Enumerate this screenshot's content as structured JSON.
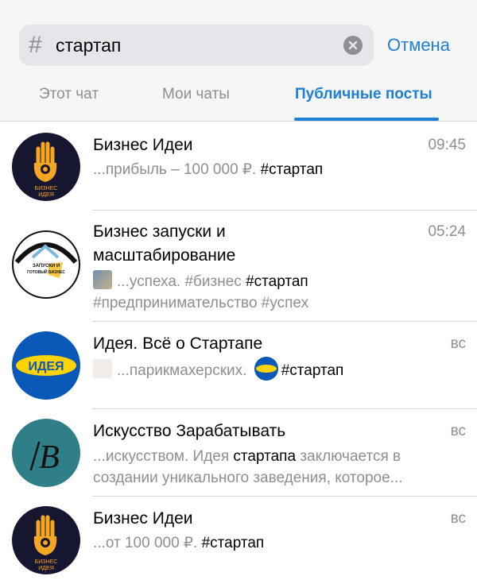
{
  "search": {
    "hash": "#",
    "query": "стартап",
    "cancel_label": "Отмена"
  },
  "tabs": [
    {
      "label": "Этот чат"
    },
    {
      "label": "Мои чаты"
    },
    {
      "label": "Публичные посты"
    }
  ],
  "results": [
    {
      "title": "Бизнес Идеи",
      "time": "09:45",
      "snippet_pre": "...прибыль – 100 000 ₽. ",
      "snippet_tag": "#стартап",
      "avatar": {
        "text1": "БИЗНЕС",
        "text2": "ИДЕЯ"
      }
    },
    {
      "title_line1": "Бизнес запуски и",
      "title_line2": "масштабирование",
      "time": "05:24",
      "snippet_pre": "...успеха. #бизнес ",
      "snippet_tag": "#стартап",
      "snippet_line2": "#предпринимательство #успех",
      "avatar": {
        "text1": "ЗАПУСКИ И",
        "text2": "ГОТОВЫЙ БИЗНЕС"
      }
    },
    {
      "title": "Идея. Всё о Стартапе",
      "time": "вс",
      "snippet_pre": "...парикмахерских. ",
      "snippet_tag": "#стартап",
      "avatar": {
        "text1": "ИДЕЯ"
      }
    },
    {
      "title": "Искусство Зарабатывать",
      "time": "вс",
      "snippet_pre": "...искусством. Идея ",
      "snippet_tag": "стартапа",
      "snippet_post": " заключается в",
      "snippet_line2": "создании уникального заведения, которое...",
      "avatar": {
        "text1": "B"
      }
    },
    {
      "title": "Бизнес Идеи",
      "time": "вс",
      "snippet_pre": "...от 100 000 ₽. ",
      "snippet_tag": "#стартап",
      "avatar": {
        "text1": "БИЗНЕС",
        "text2": "ИДЕЯ"
      }
    }
  ],
  "colors": {
    "accent": "#1e7fd6",
    "secondary_text": "#8e8e93",
    "background": "#f6f6f7"
  }
}
